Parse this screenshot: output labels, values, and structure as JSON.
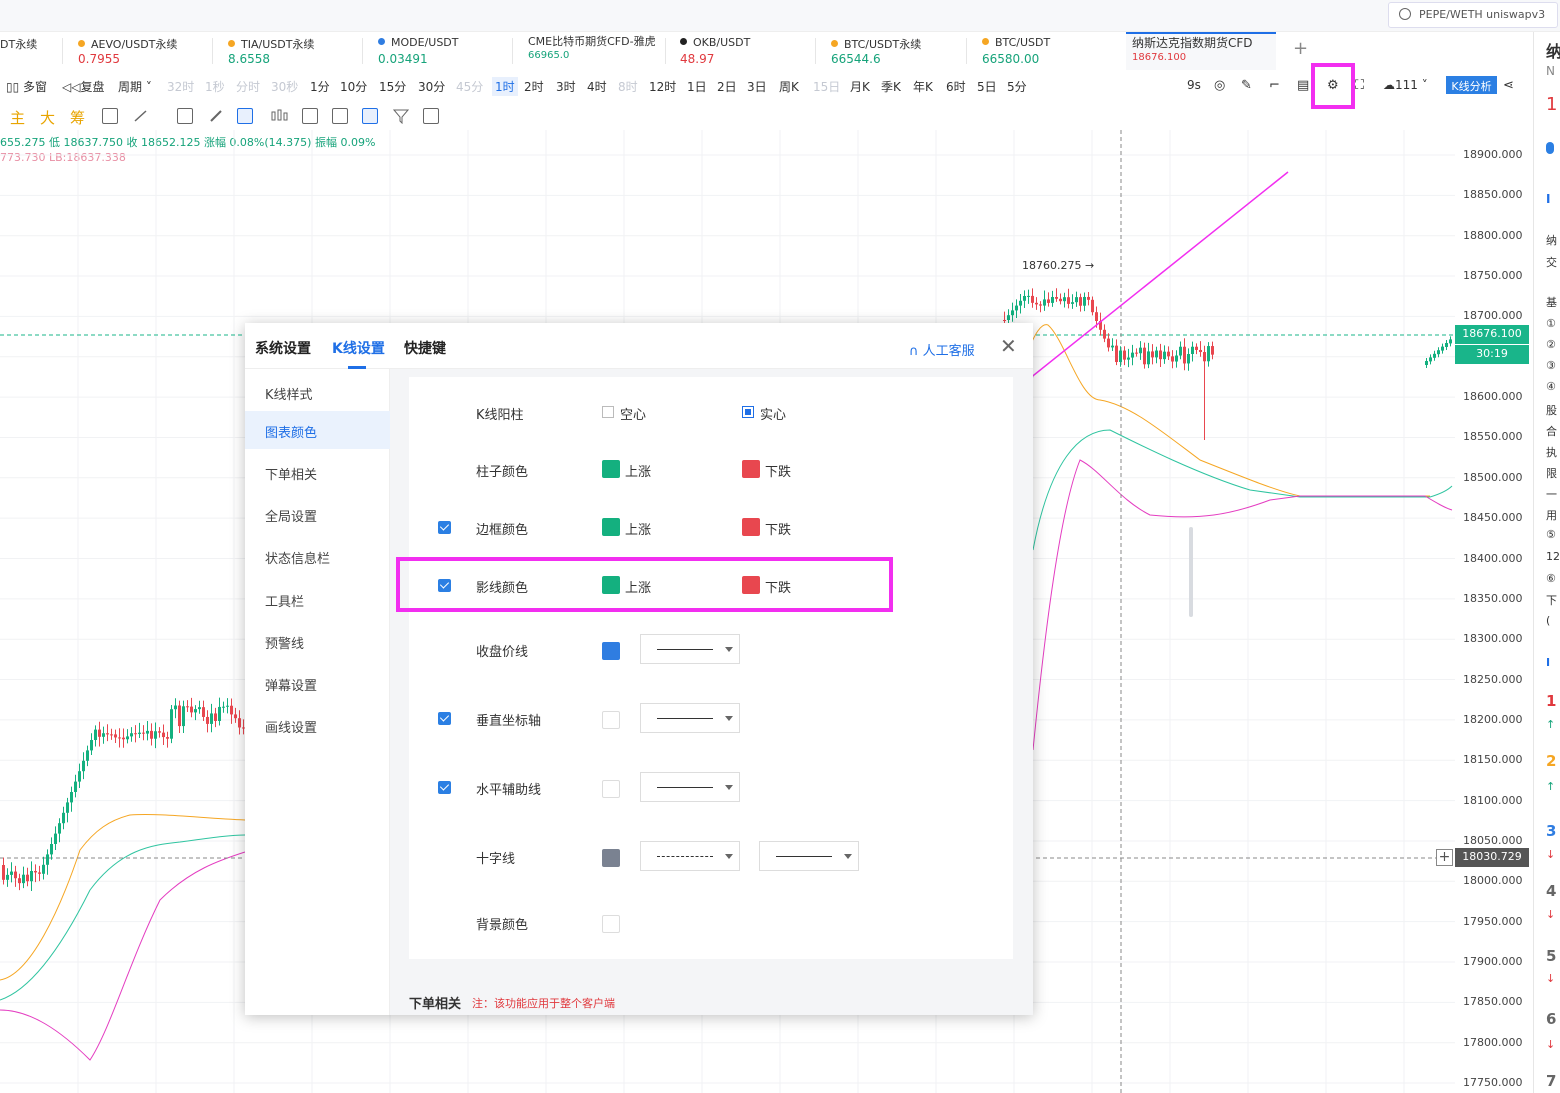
{
  "top": {
    "search_placeholder": "PEPE/WETH uniswapv3"
  },
  "tabs": [
    {
      "name": "DT永续",
      "price": "",
      "color": "#e0393e",
      "dot": ""
    },
    {
      "name": "AEVO/USDT永续",
      "price": "0.7955",
      "color": "#e0393e",
      "dot": "#f5a623"
    },
    {
      "name": "TIA/USDT永续",
      "price": "8.6558",
      "color": "#16a37a",
      "dot": "#f5a623"
    },
    {
      "name": "MODE/USDT",
      "price": "0.03491",
      "color": "#16a37a",
      "dot": "#2f7de1"
    },
    {
      "name": "CME比特币期货CFD-雅虎",
      "price": "66965.0",
      "color": "#16a37a",
      "dot": ""
    },
    {
      "name": "OKB/USDT",
      "price": "48.97",
      "color": "#e0393e",
      "dot": "#222"
    },
    {
      "name": "BTC/USDT永续",
      "price": "66544.6",
      "color": "#16a37a",
      "dot": "#f5a623"
    },
    {
      "name": "BTC/USDT",
      "price": "66580.00",
      "color": "#16a37a",
      "dot": "#f5a623"
    },
    {
      "name": "纳斯达克指数期货CFD",
      "price": "18676.100",
      "color": "#e0393e",
      "dot": ""
    }
  ],
  "toolbar": {
    "multiwin": "多窗",
    "replay": "复盘",
    "period": "周期",
    "periods": [
      {
        "t": "32时",
        "s": "dim"
      },
      {
        "t": "1秒",
        "s": "dim"
      },
      {
        "t": "分时",
        "s": "dim"
      },
      {
        "t": "30秒",
        "s": "dim"
      },
      {
        "t": "1分",
        "s": ""
      },
      {
        "t": "10分",
        "s": ""
      },
      {
        "t": "15分",
        "s": ""
      },
      {
        "t": "30分",
        "s": ""
      },
      {
        "t": "45分",
        "s": "dim"
      },
      {
        "t": "1时",
        "s": "act"
      },
      {
        "t": "2时",
        "s": ""
      },
      {
        "t": "3时",
        "s": ""
      },
      {
        "t": "4时",
        "s": ""
      },
      {
        "t": "8时",
        "s": "dim"
      },
      {
        "t": "12时",
        "s": ""
      },
      {
        "t": "1日",
        "s": ""
      },
      {
        "t": "2日",
        "s": ""
      },
      {
        "t": "3日",
        "s": ""
      },
      {
        "t": "周K",
        "s": ""
      },
      {
        "t": "15日",
        "s": "dim"
      },
      {
        "t": "月K",
        "s": ""
      },
      {
        "t": "季K",
        "s": ""
      },
      {
        "t": "年K",
        "s": ""
      },
      {
        "t": "6时",
        "s": ""
      },
      {
        "t": "5日",
        "s": ""
      },
      {
        "t": "5分",
        "s": ""
      }
    ],
    "refresh": "9s",
    "cloud_count": "111",
    "analysis": "K线分析",
    "tool_zhu": "主",
    "tool_da": "大",
    "tool_chou": "筹"
  },
  "status": {
    "line1": "655.275 低 18637.750 收 18652.125 涨幅 0.08%(14.375) 振幅 0.09%",
    "line2": "773.730 LB:18637.338"
  },
  "axis": {
    "labels": [
      "18900.000",
      "18850.000",
      "18800.000",
      "18750.000",
      "18700.000",
      "18650.000",
      "18600.000",
      "18550.000",
      "18500.000",
      "18450.000",
      "18400.000",
      "18350.000",
      "18300.000",
      "18250.000",
      "18200.000",
      "18150.000",
      "18100.000",
      "18050.000",
      "18000.000",
      "17950.000",
      "17900.000",
      "17850.000",
      "17800.000",
      "17750.000"
    ],
    "current_price": "18676.100",
    "countdown": "30:19",
    "cursor_price": "18030.729",
    "high_marker": "18760.275 →"
  },
  "dialog": {
    "tabs": [
      "系统设置",
      "K线设置",
      "快捷键"
    ],
    "support": "人工客服",
    "close": "✕",
    "side": [
      "K线样式",
      "图表颜色",
      "下单相关",
      "全局设置",
      "状态信息栏",
      "工具栏",
      "预警线",
      "弹幕设置",
      "画线设置"
    ],
    "rows": {
      "yang": {
        "label": "K线阳柱",
        "opt1": "空心",
        "opt2": "实心"
      },
      "body": {
        "label": "柱子颜色",
        "up": "上涨",
        "down": "下跌"
      },
      "border": {
        "label": "边框颜色",
        "up": "上涨",
        "down": "下跌"
      },
      "shadow": {
        "label": "影线颜色",
        "up": "上涨",
        "down": "下跌"
      },
      "close": {
        "label": "收盘价线"
      },
      "vaxis": {
        "label": "垂直坐标轴"
      },
      "hgrid": {
        "label": "水平辅助线"
      },
      "cross": {
        "label": "十字线"
      },
      "bg": {
        "label": "背景颜色"
      }
    },
    "order_header": "下单相关",
    "order_note": "注：该功能应用于整个客户端"
  },
  "colors": {
    "up": "#14b07f",
    "down": "#e8474f",
    "accent": "#1f6fe6",
    "highlight": "#f22ef0",
    "close_line": "#2f7de1",
    "cross": "#7a8291"
  },
  "rightpanel": [
    "纳",
    "N",
    "1",
    "",
    "I",
    "纳",
    "交",
    "基",
    "①",
    "②",
    "③",
    "④",
    "股",
    "合",
    "执",
    "限",
    "一",
    "用",
    "⑤",
    "12",
    "⑥",
    "下",
    "(",
    "",
    "I",
    "1",
    "↑",
    "2",
    "↑",
    "3",
    "↓",
    "4",
    "↓",
    "5",
    "↓",
    "6",
    "↓",
    "7"
  ]
}
